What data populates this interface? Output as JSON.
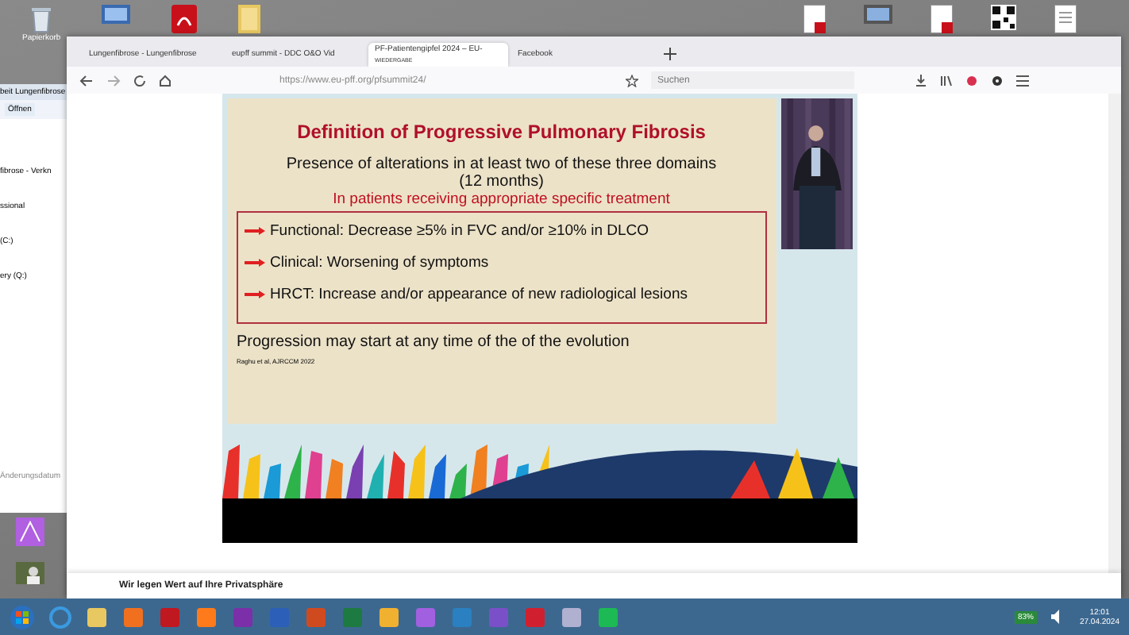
{
  "desktop": {
    "icons": [
      {
        "label": "Papierkorb"
      }
    ]
  },
  "explorer": {
    "title": "beit Lungenfibrose",
    "toolbar": "Öffnen",
    "lines": [
      "fibrose - Verkn",
      "ssional",
      "(C:)",
      "ery (Q:)"
    ],
    "column": "Änderungsdatum"
  },
  "browser": {
    "tabs": [
      {
        "title": "Lungenfibrose - Lungenfibrose",
        "selected": false
      },
      {
        "title": "eupff summit - DDC O&O Vid",
        "selected": false
      },
      {
        "title": "PF-Patientengipfel 2024 – EU-",
        "subtitle": "WIEDERGABE",
        "selected": true
      },
      {
        "title": "Facebook",
        "selected": false
      }
    ],
    "url": {
      "host": "https://www.eu-pff.org",
      "path": "/pfsummit24/"
    },
    "search": {
      "placeholder": "Suchen"
    }
  },
  "slide": {
    "title": "Definition of Progressive Pulmonary Fibrosis",
    "intro": "Presence of alterations in at least two of these three domains",
    "period": "(12 months)",
    "condition": "In patients receiving appropriate specific treatment",
    "criteria": [
      "Functional: Decrease ≥5% in FVC and/or ≥10% in DLCO",
      "Clinical: Worsening of symptoms",
      "HRCT: Increase and/or appearance of new radiological lesions"
    ],
    "footer": "Progression may start at any time of the of the evolution",
    "citation": "Raghu et al, AJRCCM 2022"
  },
  "cookie_banner": {
    "title": "Wir legen Wert auf Ihre Privatsphäre"
  },
  "taskbar": {
    "battery": "83%",
    "time": "12:01",
    "date": "27.04.2024"
  }
}
